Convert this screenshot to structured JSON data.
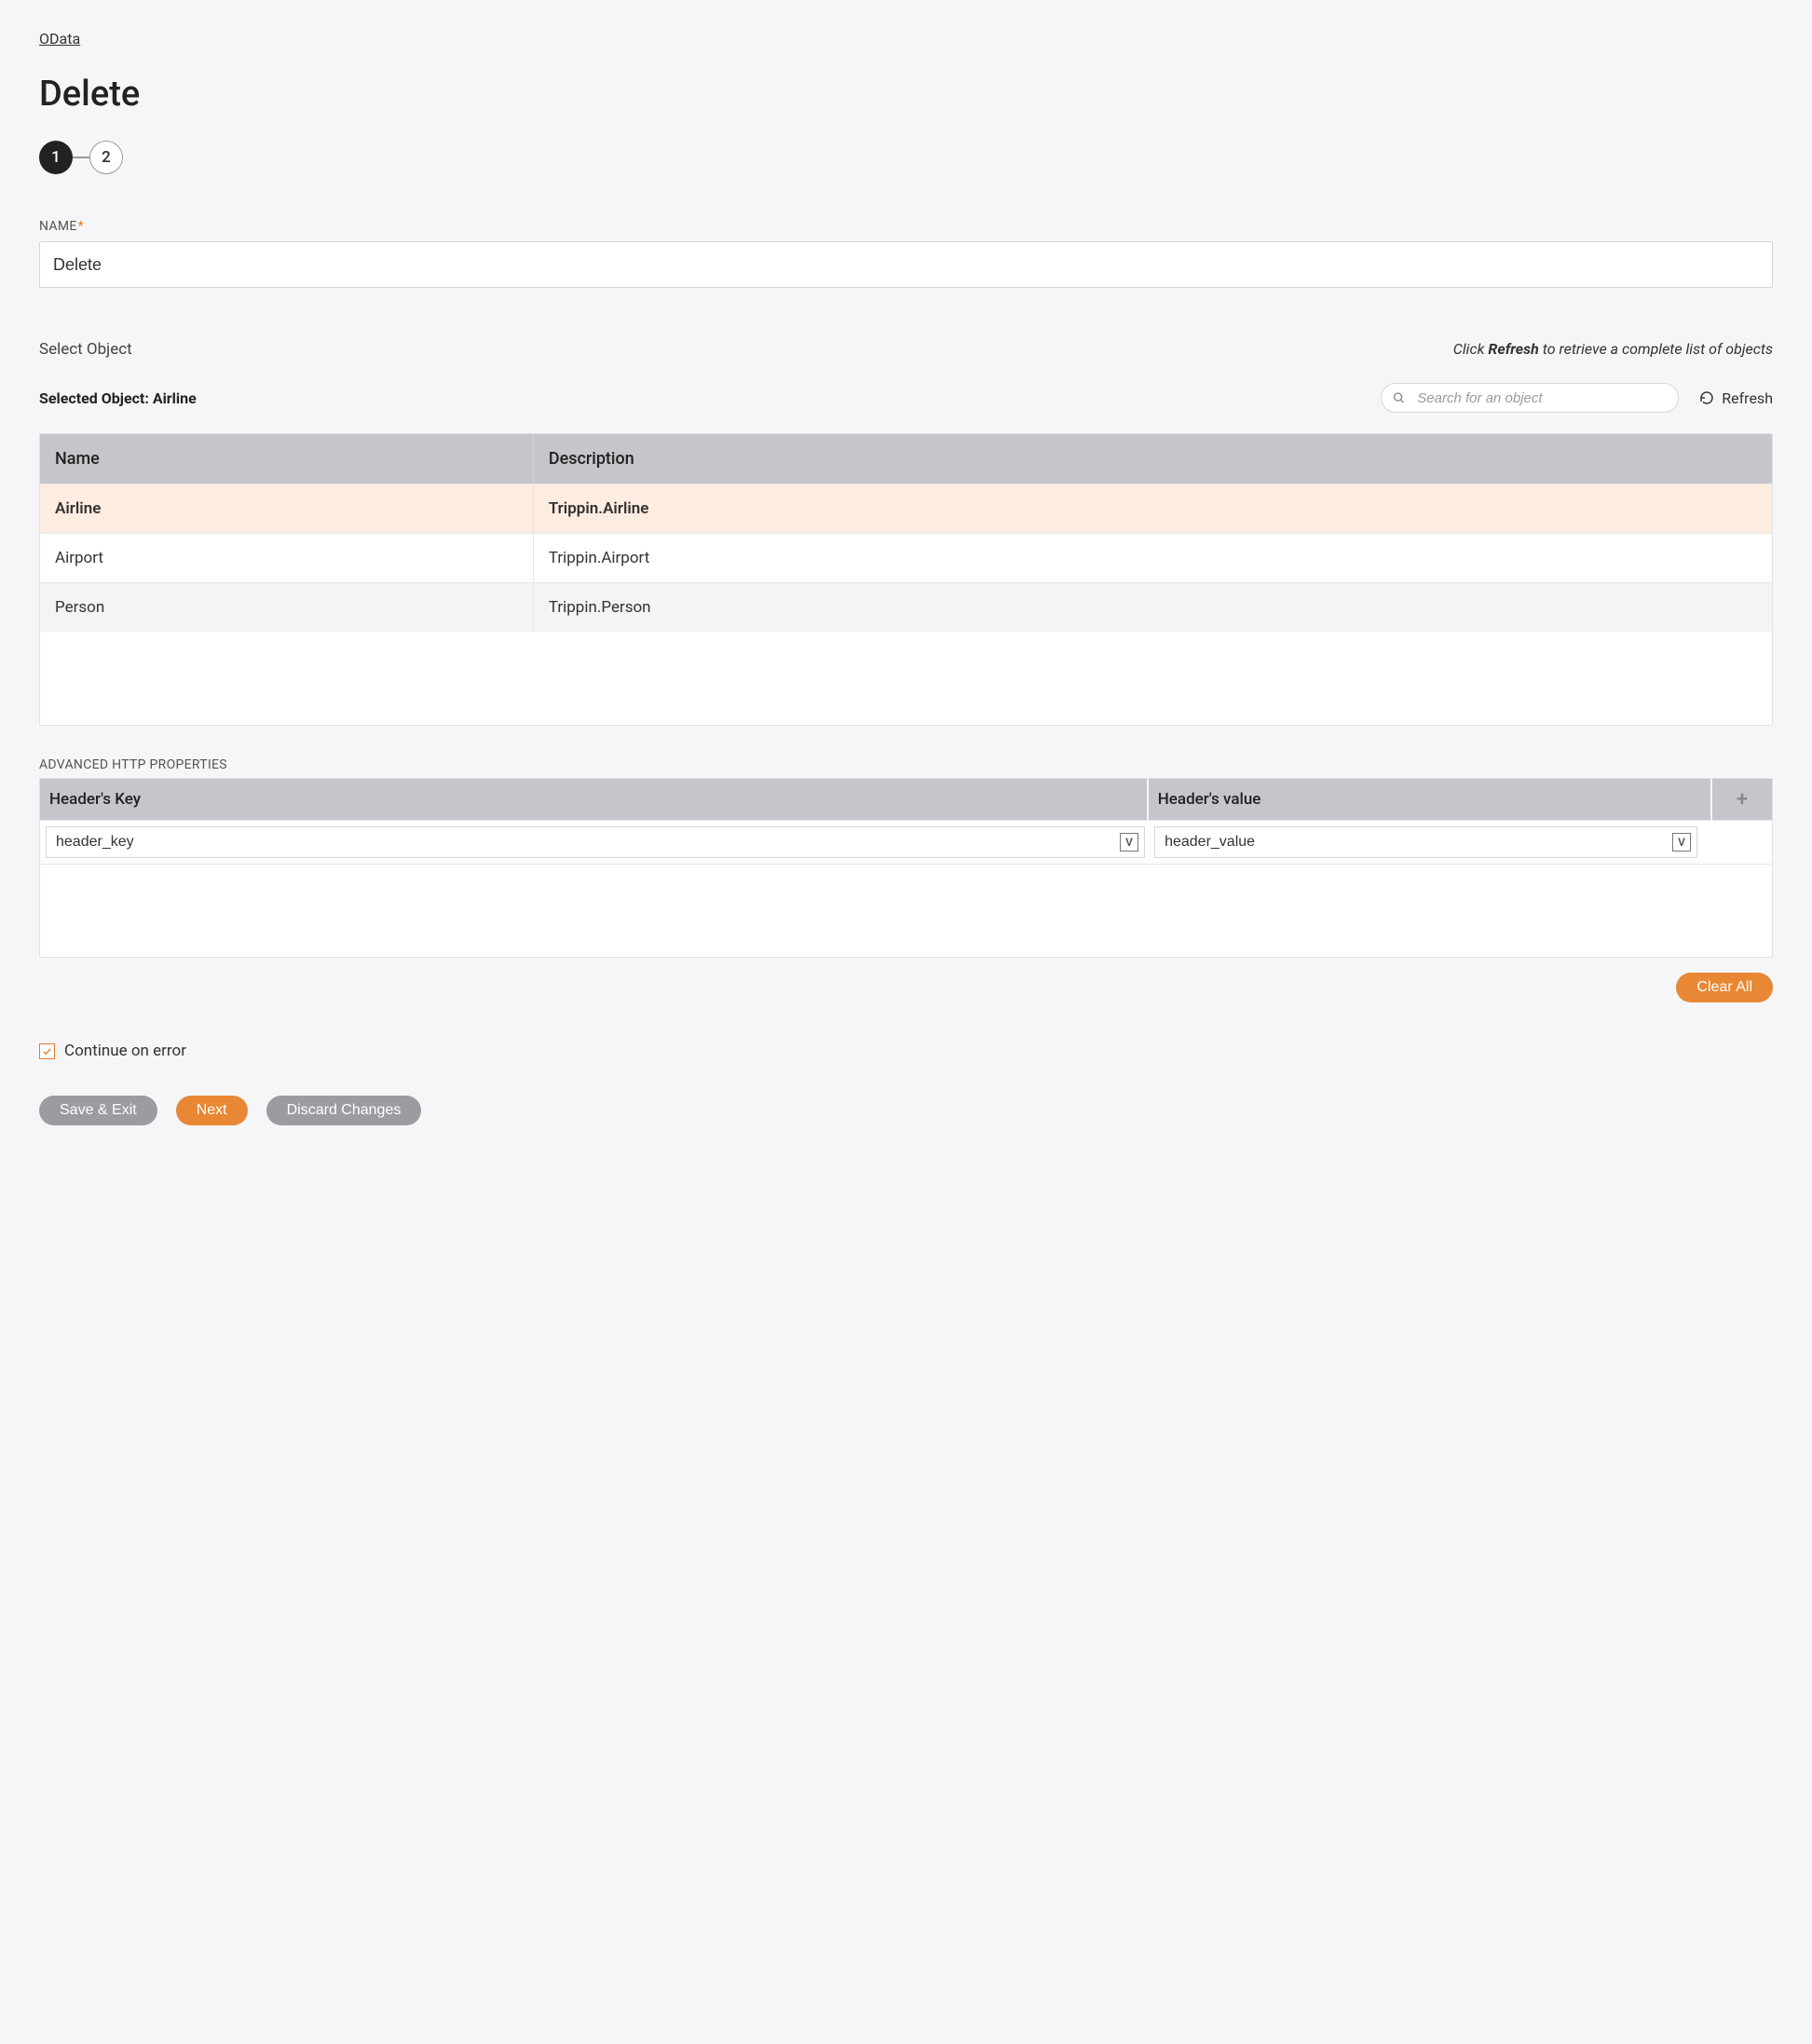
{
  "breadcrumb": "OData",
  "pageTitle": "Delete",
  "stepper": {
    "steps": [
      "1",
      "2"
    ],
    "active": 0
  },
  "nameField": {
    "label": "NAME",
    "value": "Delete"
  },
  "selectObject": {
    "label": "Select Object",
    "hintPrefix": "Click ",
    "hintBold": "Refresh",
    "hintSuffix": " to retrieve a complete list of objects",
    "selectedLabel": "Selected Object: ",
    "selectedValue": "Airline",
    "searchPlaceholder": "Search for an object",
    "refreshLabel": "Refresh",
    "columns": {
      "name": "Name",
      "description": "Description"
    },
    "rows": [
      {
        "name": "Airline",
        "description": "Trippin.Airline",
        "selected": true
      },
      {
        "name": "Airport",
        "description": "Trippin.Airport",
        "selected": false
      },
      {
        "name": "Person",
        "description": "Trippin.Person",
        "selected": false
      }
    ]
  },
  "httpProps": {
    "label": "ADVANCED HTTP PROPERTIES",
    "columns": {
      "key": "Header's Key",
      "value": "Header's value"
    },
    "row": {
      "key": "header_key",
      "value": "header_value"
    },
    "vBadge": "V",
    "clearAll": "Clear All"
  },
  "continueOnError": {
    "label": "Continue on error",
    "checked": true
  },
  "footer": {
    "saveExit": "Save & Exit",
    "next": "Next",
    "discard": "Discard Changes"
  }
}
